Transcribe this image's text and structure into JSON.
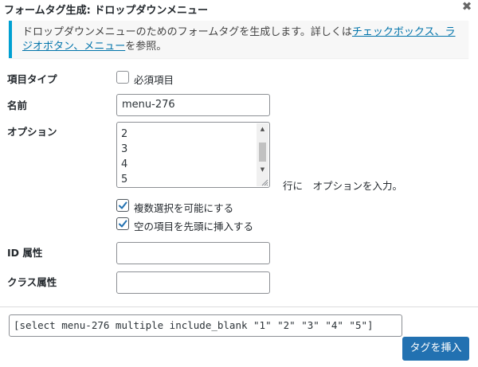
{
  "dialog": {
    "title": "フォームタグ生成: ドロップダウンメニュー",
    "close_glyph": "✖"
  },
  "notice": {
    "text_before": "ドロップダウンメニューのためのフォームタグを生成します。詳しくは",
    "link_text": "チェックボックス、ラジオボタン、メニュー",
    "text_after": "を参照。"
  },
  "form": {
    "field_type": {
      "label": "項目タイプ",
      "required_label": "必須項目",
      "required_checked": false
    },
    "name": {
      "label": "名前",
      "value": "menu-276"
    },
    "options": {
      "label": "オプション",
      "visible_lines": [
        "2",
        "3",
        "4",
        "5"
      ],
      "hint": "行に　オプションを入力。"
    },
    "multiple": {
      "label": "複数選択を可能にする",
      "checked": true
    },
    "include_blank": {
      "label": "空の項目を先頭に挿入する",
      "checked": true
    },
    "id_attr": {
      "label": "ID 属性",
      "value": ""
    },
    "class_attr": {
      "label": "クラス属性",
      "value": ""
    }
  },
  "footer": {
    "shortcode": "[select menu-276 multiple include_blank \"1\" \"2\" \"3\" \"4\" \"5\"]",
    "insert_button": "タグを挿入"
  },
  "colors": {
    "accent": "#2271b1",
    "notice_border": "#00a0d2",
    "link": "#0073aa"
  }
}
